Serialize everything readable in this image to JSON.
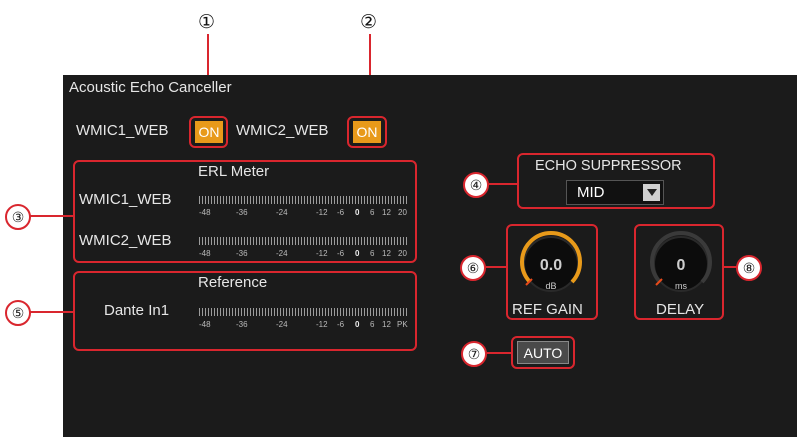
{
  "callouts": [
    "①",
    "②",
    "③",
    "④",
    "⑤",
    "⑥",
    "⑦",
    "⑧"
  ],
  "panel": {
    "title": "Acoustic Echo Canceller"
  },
  "channels": [
    {
      "name": "WMIC1_WEB",
      "state": "ON"
    },
    {
      "name": "WMIC2_WEB",
      "state": "ON"
    }
  ],
  "erl": {
    "title": "ERL Meter",
    "rows": [
      "WMIC1_WEB",
      "WMIC2_WEB"
    ],
    "ticks": [
      "-48",
      "-36",
      "-24",
      "-12",
      "-6",
      "0",
      "6",
      "12",
      "20"
    ]
  },
  "reference": {
    "title": "Reference",
    "row": "Dante In1",
    "ticks": [
      "-48",
      "-36",
      "-24",
      "-12",
      "-6",
      "0",
      "6",
      "12",
      "PK"
    ]
  },
  "echo_suppressor": {
    "title": "ECHO SUPPRESSOR",
    "value": "MID"
  },
  "ref_gain": {
    "value": "0.0",
    "unit": "dB",
    "label": "REF GAIN"
  },
  "delay": {
    "value": "0",
    "unit": "ms",
    "label": "DELAY"
  },
  "auto": {
    "label": "AUTO"
  },
  "colors": {
    "accent": "#e89a1a",
    "callout": "#d9262e",
    "panel_bg": "#1b1b1b"
  }
}
